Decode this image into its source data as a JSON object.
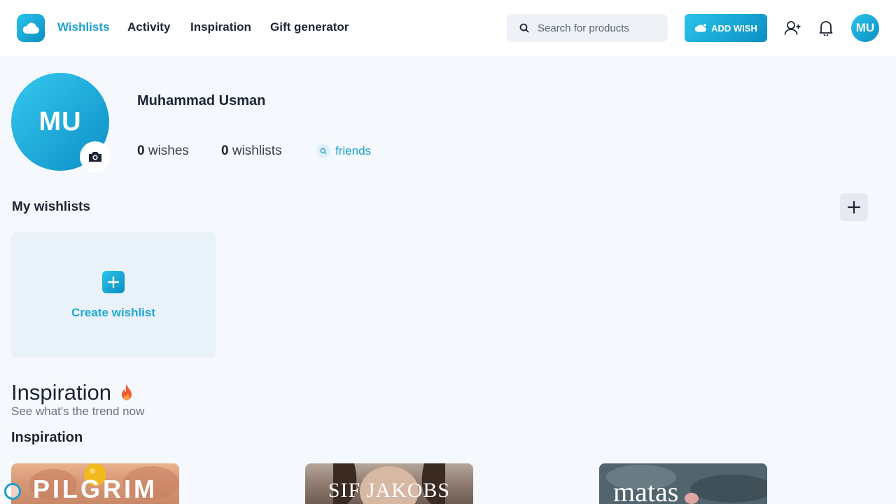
{
  "nav": {
    "links": [
      "Wishlists",
      "Activity",
      "Inspiration",
      "Gift generator"
    ],
    "search_placeholder": "Search for products",
    "add_wish_label": "ADD WISH",
    "avatar_initials": "MU"
  },
  "profile": {
    "initials": "MU",
    "name": "Muhammad Usman",
    "wishes_count": "0",
    "wishes_label": "wishes",
    "wishlists_count": "0",
    "wishlists_label": "wishlists",
    "friends_label": "friends"
  },
  "my_wishlists": {
    "title": "My wishlists",
    "create_label": "Create wishlist"
  },
  "inspiration": {
    "heading": "Inspiration",
    "subtitle": "See what's the trend now",
    "section_title": "Inspiration",
    "cards": [
      {
        "brand": "PILGRIM"
      },
      {
        "brand": "SIF JAKOBS"
      },
      {
        "brand": "matas"
      }
    ]
  },
  "colors": {
    "accent": "#1a9fd0",
    "gradient_start": "#2ac3ea",
    "gradient_end": "#0b8fc4",
    "background": "#f5f8fc"
  }
}
